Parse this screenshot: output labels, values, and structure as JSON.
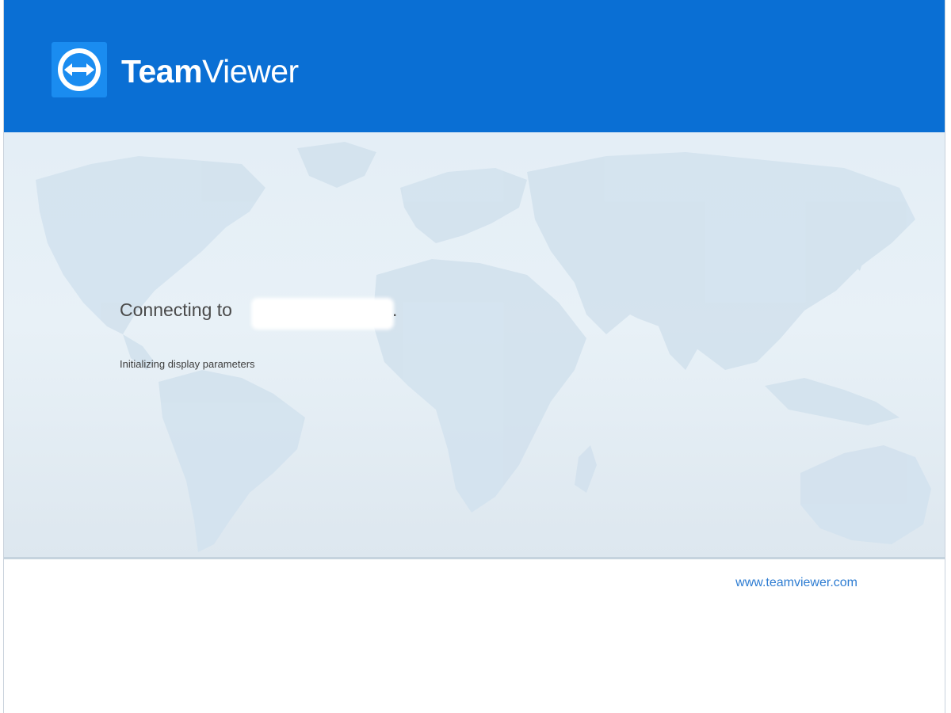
{
  "header": {
    "brand_bold": "Team",
    "brand_light": "Viewer",
    "background_color": "#0a6fd4",
    "logo_icon": "teamviewer-double-arrow-icon"
  },
  "main": {
    "connecting_label": "Connecting to",
    "connecting_target_redacted": true,
    "trailing_period": ".",
    "status_text": "Initializing display parameters",
    "background": "world-map"
  },
  "footer": {
    "link_text": "www.teamviewer.com",
    "link_color": "#2d7cd2"
  }
}
